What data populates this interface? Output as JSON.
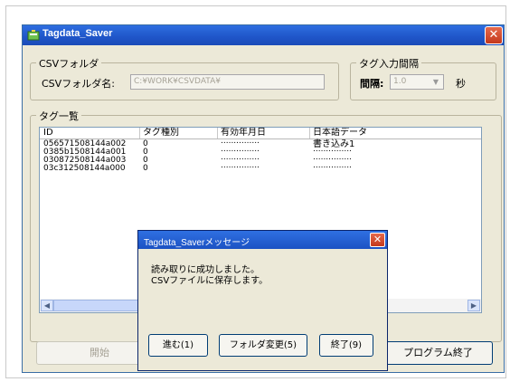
{
  "window": {
    "title": "Tagdata_Saver",
    "close_label": "✕"
  },
  "csv_group": {
    "legend": "CSVフォルダ",
    "label": "CSVフォルダ名:",
    "value": "C:¥WORK¥CSVDATA¥"
  },
  "interval_group": {
    "legend": "タグ入力間隔",
    "label": "間隔:",
    "value": "1.0",
    "unit": "秒"
  },
  "tag_list": {
    "legend": "タグ一覧",
    "columns": [
      "ID",
      "タグ種別",
      "有効年月日",
      "日本語データ"
    ],
    "rows": [
      [
        "056571508144a002",
        "0",
        "...............",
        "書き込み1"
      ],
      [
        "0385b1508144a001",
        "0",
        "...............",
        "..............."
      ],
      [
        "030872508144a003",
        "0",
        "...............",
        "..............."
      ],
      [
        "03c312508144a000",
        "0",
        "...............",
        "..............."
      ]
    ]
  },
  "buttons": {
    "start": "開始",
    "exit_program": "プログラム終了"
  },
  "dialog": {
    "title": "Tagdata_Saverメッセージ",
    "close_label": "✕",
    "message_line1": "読み取りに成功しました。",
    "message_line2": "CSVファイルに保存します。",
    "next_button": "進む(1)",
    "change_folder_button": "フォルダ変更(5)",
    "end_button": "終了(9)"
  },
  "colors": {
    "titlebar": "#1f55c8",
    "window_bg": "#ece9d8",
    "close": "#c4381c"
  }
}
